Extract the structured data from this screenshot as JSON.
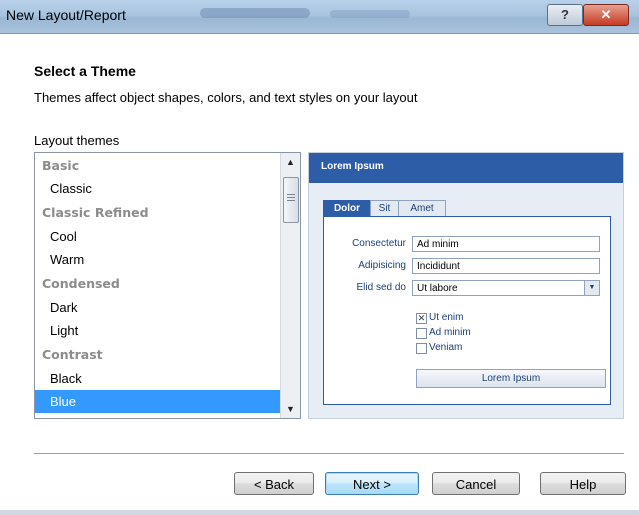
{
  "window": {
    "title": "New Layout/Report",
    "help_label": "?",
    "close_label": "✕"
  },
  "header": {
    "title": "Select a Theme",
    "description": "Themes affect object shapes, colors, and text styles on your layout"
  },
  "themes": {
    "label": "Layout themes",
    "items": [
      {
        "label": "Basic",
        "type": "group"
      },
      {
        "label": "Classic",
        "type": "child"
      },
      {
        "label": "Classic Refined",
        "type": "group"
      },
      {
        "label": "Cool",
        "type": "child"
      },
      {
        "label": "Warm",
        "type": "child"
      },
      {
        "label": "Condensed",
        "type": "group"
      },
      {
        "label": "Dark",
        "type": "child"
      },
      {
        "label": "Light",
        "type": "child"
      },
      {
        "label": "Contrast",
        "type": "group"
      },
      {
        "label": "Black",
        "type": "child"
      },
      {
        "label": "Blue",
        "type": "child",
        "selected": true
      }
    ],
    "scroll_up_icon": "▲",
    "scroll_down_icon": "▼"
  },
  "preview": {
    "header": "Lorem Ipsum",
    "tabs": [
      "Dolor",
      "Sit",
      "Amet"
    ],
    "fields": [
      {
        "label": "Consectetur",
        "value": "Ad minim"
      },
      {
        "label": "Adipisicing",
        "value": "Incididunt"
      },
      {
        "label": "Elid sed do",
        "value": "Ut labore"
      }
    ],
    "dropdown_icon": "▼",
    "checkboxes": [
      {
        "label": "Ut enim",
        "checked": true
      },
      {
        "label": "Ad minim",
        "checked": false
      },
      {
        "label": "Veniam",
        "checked": false
      }
    ],
    "check_mark": "✕",
    "button": "Lorem Ipsum"
  },
  "footer": {
    "back": "< Back",
    "next": "Next >",
    "cancel": "Cancel",
    "help": "Help"
  },
  "colors": {
    "selection": "#3399ff",
    "preview_accent": "#2e5da8"
  }
}
